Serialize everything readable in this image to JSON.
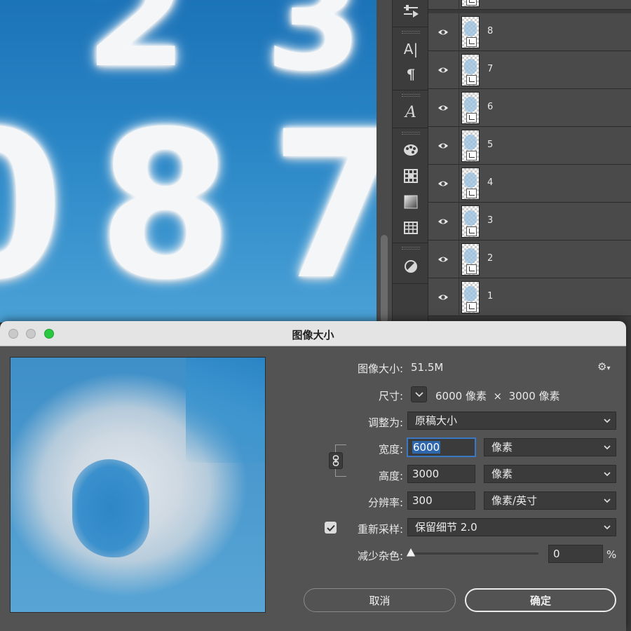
{
  "canvas": {
    "digits": [
      {
        "char": "2",
        "name": "cloud-digit-2"
      },
      {
        "char": "3",
        "name": "cloud-digit-3"
      },
      {
        "char": "8",
        "name": "cloud-digit-8"
      },
      {
        "char": "7",
        "name": "cloud-digit-7"
      },
      {
        "char": "0",
        "name": "cloud-digit-0"
      }
    ]
  },
  "toolbar": {
    "icons": [
      "sliders-icon",
      "character-icon",
      "paragraph-icon",
      "glyphs-icon",
      "swatches-icon",
      "patterns-icon",
      "gradient-icon",
      "grid-icon",
      "adjustments-icon"
    ]
  },
  "layers": [
    {
      "name": "8"
    },
    {
      "name": "7"
    },
    {
      "name": "6"
    },
    {
      "name": "5"
    },
    {
      "name": "4"
    },
    {
      "name": "3"
    },
    {
      "name": "2"
    },
    {
      "name": "1"
    }
  ],
  "dialog": {
    "title": "图像大小",
    "image_size_label": "图像大小:",
    "image_size_value": "51.5M",
    "dimensions_label": "尺寸:",
    "dimensions_value": "6000 像素  ×  3000 像素",
    "fit_to_label": "调整为:",
    "fit_to_value": "原稿大小",
    "width_label": "宽度:",
    "width_value": "6000",
    "width_unit": "像素",
    "height_label": "高度:",
    "height_value": "3000",
    "height_unit": "像素",
    "resolution_label": "分辨率:",
    "resolution_value": "300",
    "resolution_unit": "像素/英寸",
    "resample_label": "重新采样:",
    "resample_checked": true,
    "resample_value": "保留细节 2.0",
    "noise_label": "减少杂色:",
    "noise_value": "0",
    "noise_unit": "%",
    "cancel_label": "取消",
    "ok_label": "确定"
  },
  "colors": {
    "traffic_close": "#c9c9c9",
    "traffic_min": "#c9c9c9",
    "traffic_max": "#2ac840",
    "accent": "#3b78c4"
  }
}
